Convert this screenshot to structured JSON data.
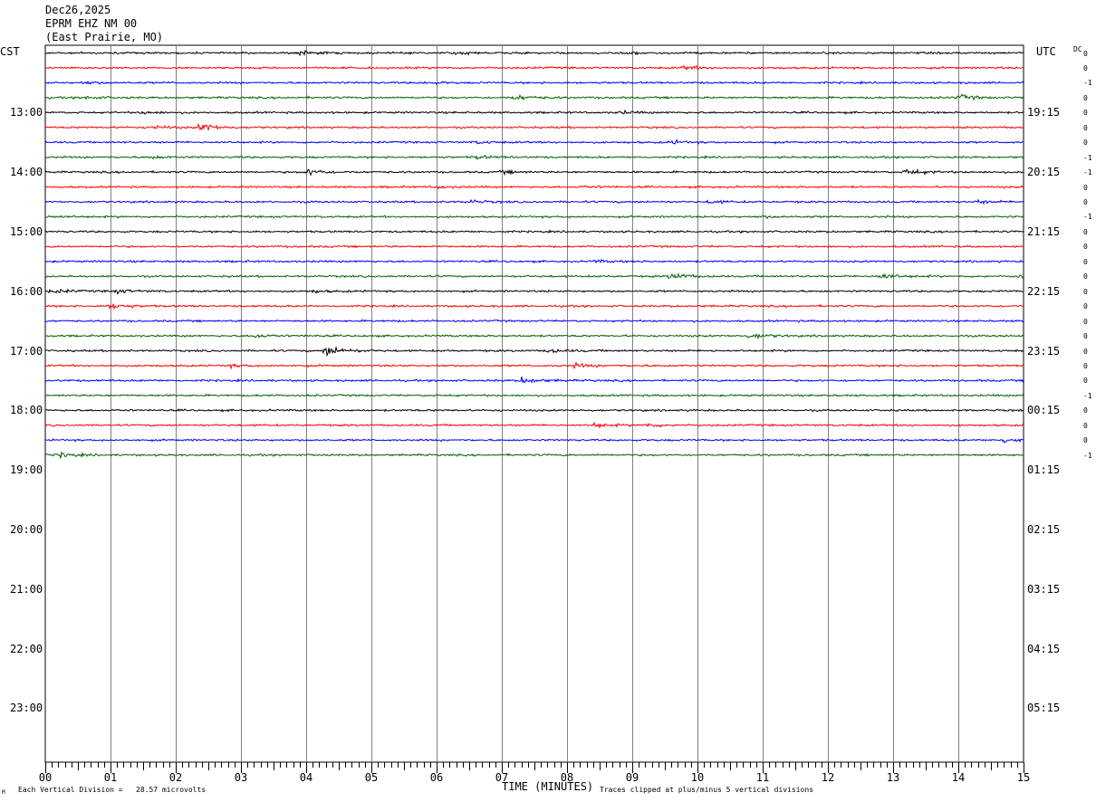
{
  "header": {
    "date": "Dec26,2025",
    "station": "EPRM EHZ NM 00",
    "location": "(East Prairie, MO)"
  },
  "left_zone": "CST",
  "right_zone": "UTC",
  "dc_label": "DC",
  "footer": {
    "scale": "Each Vertical Division =   28.57 microvolts",
    "clip": "Traces clipped at plus/minus 5 vertical divisions",
    "mark": "M"
  },
  "colors": {
    "trace_cycle": [
      "#000000",
      "#ff0000",
      "#0000ff",
      "#006400"
    ],
    "grid": "#808080"
  },
  "chart_data": {
    "type": "line",
    "title": "EPRM EHZ NM 00 (East Prairie, MO)",
    "xlabel": "TIME (MINUTES)",
    "xlim": [
      0,
      15
    ],
    "x_ticks": [
      "00",
      "01",
      "02",
      "03",
      "04",
      "05",
      "06",
      "07",
      "08",
      "09",
      "10",
      "11",
      "12",
      "13",
      "14",
      "15"
    ],
    "row_minutes": 15,
    "rows_total": 48,
    "rows_with_data": 28,
    "left_time_labels": [
      "13:00",
      "14:00",
      "15:00",
      "16:00",
      "17:00",
      "18:00",
      "19:00",
      "20:00",
      "21:00",
      "22:00",
      "23:00"
    ],
    "right_time_labels": [
      "19:15",
      "20:15",
      "21:15",
      "22:15",
      "23:15",
      "00:15",
      "01:15",
      "02:15",
      "03:15",
      "04:15",
      "05:15"
    ],
    "dc_offsets": [
      "0",
      "0",
      "-1",
      "0",
      "0",
      "0",
      "0",
      "-1",
      "-1",
      "0",
      "0",
      "-1",
      "0",
      "0",
      "0",
      "0",
      "0",
      "0",
      "0",
      "0",
      "0",
      "0",
      "0",
      "-1",
      "0",
      "0",
      "0",
      "-1"
    ],
    "trace_colors_by_row": [
      "black",
      "red",
      "blue",
      "green"
    ],
    "events": [
      {
        "row": 0,
        "minute": 3.9,
        "amp": 1.0
      },
      {
        "row": 0,
        "minute": 6.3,
        "amp": 0.8
      },
      {
        "row": 0,
        "minute": 9.0,
        "amp": 0.6
      },
      {
        "row": 1,
        "minute": 9.8,
        "amp": 1.0
      },
      {
        "row": 2,
        "minute": 0.6,
        "amp": 0.7
      },
      {
        "row": 2,
        "minute": 5.8,
        "amp": 0.7
      },
      {
        "row": 3,
        "minute": 7.2,
        "amp": 1.4
      },
      {
        "row": 3,
        "minute": 14.0,
        "amp": 1.3
      },
      {
        "row": 3,
        "minute": 0.6,
        "amp": 0.7
      },
      {
        "row": 4,
        "minute": 1.5,
        "amp": 0.6
      },
      {
        "row": 4,
        "minute": 8.8,
        "amp": 0.7
      },
      {
        "row": 5,
        "minute": 2.4,
        "amp": 2.2
      },
      {
        "row": 5,
        "minute": 1.6,
        "amp": 1.0
      },
      {
        "row": 6,
        "minute": 9.6,
        "amp": 0.8
      },
      {
        "row": 6,
        "minute": 6.6,
        "amp": 0.6
      },
      {
        "row": 7,
        "minute": 6.6,
        "amp": 0.8
      },
      {
        "row": 7,
        "minute": 1.6,
        "amp": 0.7
      },
      {
        "row": 8,
        "minute": 4.0,
        "amp": 1.8
      },
      {
        "row": 8,
        "minute": 13.2,
        "amp": 1.8
      },
      {
        "row": 8,
        "minute": 7.0,
        "amp": 0.8
      },
      {
        "row": 9,
        "minute": 6.0,
        "amp": 0.6
      },
      {
        "row": 9,
        "minute": 8.2,
        "amp": 0.6
      },
      {
        "row": 10,
        "minute": 6.5,
        "amp": 0.8
      },
      {
        "row": 10,
        "minute": 10.2,
        "amp": 0.8
      },
      {
        "row": 10,
        "minute": 14.3,
        "amp": 0.8
      },
      {
        "row": 11,
        "minute": 0.1,
        "amp": 0.5
      },
      {
        "row": 11,
        "minute": 11.0,
        "amp": 0.5
      },
      {
        "row": 14,
        "minute": 8.4,
        "amp": 0.6
      },
      {
        "row": 15,
        "minute": 9.6,
        "amp": 1.8
      },
      {
        "row": 15,
        "minute": 12.8,
        "amp": 1.8
      },
      {
        "row": 15,
        "minute": 14.9,
        "amp": 1.0
      },
      {
        "row": 16,
        "minute": 0.1,
        "amp": 1.0
      },
      {
        "row": 16,
        "minute": 1.1,
        "amp": 0.9
      },
      {
        "row": 16,
        "minute": 4.1,
        "amp": 0.6
      },
      {
        "row": 17,
        "minute": 1.0,
        "amp": 1.6
      },
      {
        "row": 19,
        "minute": 3.2,
        "amp": 1.0
      },
      {
        "row": 19,
        "minute": 10.8,
        "amp": 1.6
      },
      {
        "row": 20,
        "minute": 4.3,
        "amp": 3.0
      },
      {
        "row": 20,
        "minute": 7.7,
        "amp": 1.0
      },
      {
        "row": 21,
        "minute": 8.1,
        "amp": 1.0
      },
      {
        "row": 21,
        "minute": 2.8,
        "amp": 0.7
      },
      {
        "row": 22,
        "minute": 7.3,
        "amp": 1.7
      },
      {
        "row": 25,
        "minute": 8.4,
        "amp": 1.2
      },
      {
        "row": 25,
        "minute": 9.2,
        "amp": 0.9
      },
      {
        "row": 26,
        "minute": 14.7,
        "amp": 1.5
      },
      {
        "row": 27,
        "minute": 0.2,
        "amp": 1.2
      }
    ]
  }
}
